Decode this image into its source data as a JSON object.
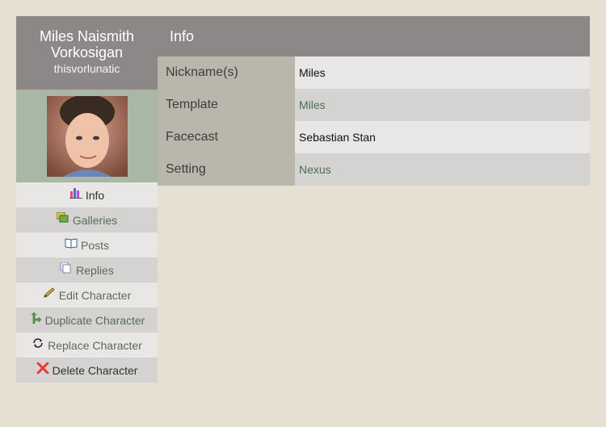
{
  "character": {
    "name": "Miles Naismith Vorkosigan",
    "username": "thisvorlunatic",
    "avatar_alt": "Sebastian Stan"
  },
  "menu": [
    {
      "label": "Info",
      "icon": "bar-chart-icon"
    },
    {
      "label": "Galleries",
      "icon": "gallery-icon"
    },
    {
      "label": "Posts",
      "icon": "book-icon"
    },
    {
      "label": "Replies",
      "icon": "pages-icon"
    },
    {
      "label": "Edit Character",
      "icon": "pencil-icon"
    },
    {
      "label": "Duplicate Character",
      "icon": "branch-arrow-icon"
    },
    {
      "label": "Replace Character",
      "icon": "refresh-icon"
    },
    {
      "label": "Delete Character",
      "icon": "delete-x-icon"
    }
  ],
  "main": {
    "title": "Info",
    "rows": [
      {
        "key": "Nickname(s)",
        "value": "Miles"
      },
      {
        "key": "Template",
        "value": "Miles"
      },
      {
        "key": "Facecast",
        "value": "Sebastian Stan"
      },
      {
        "key": "Setting",
        "value": "Nexus"
      }
    ]
  },
  "colors": {
    "page_bg": "#e6e0d3",
    "header_bg": "#8d8888",
    "key_bg": "#b9b6ac",
    "link": "#4c6f50",
    "delete": "#e83a3a"
  }
}
